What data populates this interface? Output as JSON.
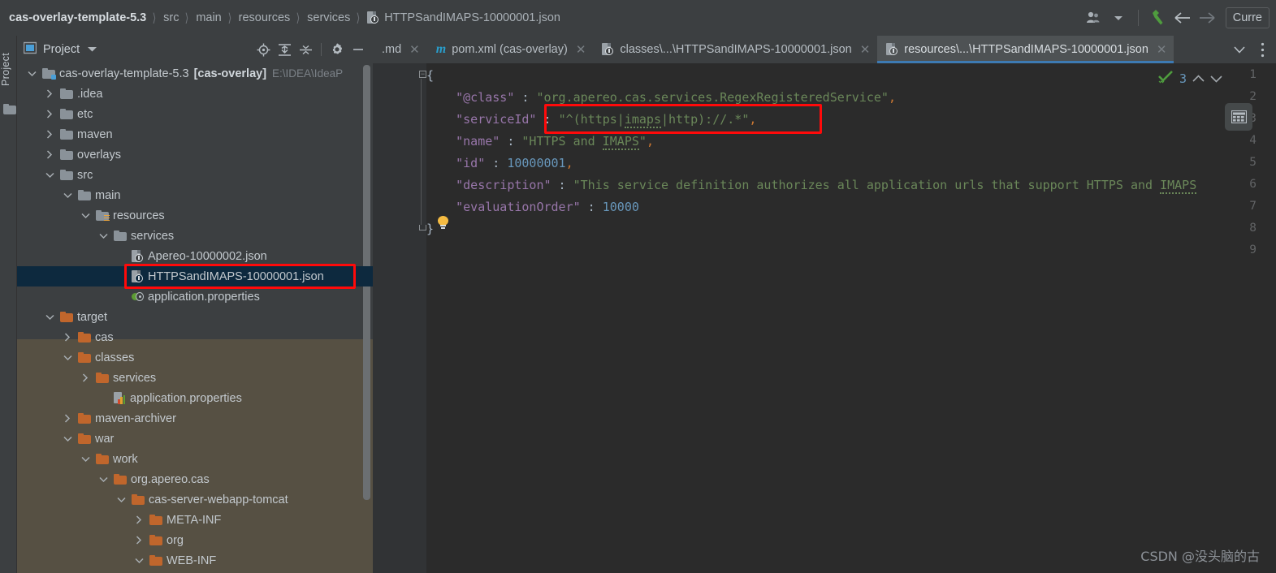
{
  "topbar": {
    "breadcrumbs": [
      {
        "label": "cas-overlay-template-5.3",
        "type": "root"
      },
      {
        "label": "src",
        "type": "dir"
      },
      {
        "label": "main",
        "type": "dir"
      },
      {
        "label": "resources",
        "type": "dir"
      },
      {
        "label": "services",
        "type": "dir"
      },
      {
        "label": "HTTPSandIMAPS-10000001.json",
        "type": "file"
      }
    ],
    "separator": "〉",
    "user_icon": "user-avatar-icon",
    "dropdown_icon": "chevron-down-icon",
    "build_icon": "hammer-icon",
    "back_icon": "arrow-left-icon",
    "forward_icon": "arrow-right-icon",
    "run_config_label": "Curre"
  },
  "toolwindow_strip": {
    "label": "Project",
    "icon": "project-folder-icon"
  },
  "panel": {
    "title": "Project",
    "caret_icon": "chevron-down-icon",
    "tools": [
      {
        "name": "locate-icon",
        "title": "Select Opened File"
      },
      {
        "name": "expand-all-icon",
        "title": "Expand All"
      },
      {
        "name": "collapse-all-icon",
        "title": "Collapse All"
      },
      {
        "name": "settings-gear-icon",
        "title": "Settings"
      },
      {
        "name": "minimize-icon",
        "title": "Hide"
      }
    ]
  },
  "tree": [
    {
      "label": "cas-overlay-template-5.3",
      "bold": "[cas-overlay]",
      "sub": "E:\\IDEA\\IdeaP",
      "indent": 0,
      "arrow": "down",
      "icon": "module-folder-icon",
      "color": "blue",
      "selected": false
    },
    {
      "label": ".idea",
      "indent": 1,
      "arrow": "right",
      "icon": "folder-icon",
      "color": "blue",
      "selected": false
    },
    {
      "label": "etc",
      "indent": 1,
      "arrow": "right",
      "icon": "folder-icon",
      "color": "blue",
      "selected": false
    },
    {
      "label": "maven",
      "indent": 1,
      "arrow": "right",
      "icon": "folder-icon",
      "color": "blue",
      "selected": false
    },
    {
      "label": "overlays",
      "indent": 1,
      "arrow": "right",
      "icon": "folder-icon",
      "color": "blue",
      "selected": false
    },
    {
      "label": "src",
      "indent": 1,
      "arrow": "down",
      "icon": "folder-icon",
      "color": "blue",
      "selected": false
    },
    {
      "label": "main",
      "indent": 2,
      "arrow": "down",
      "icon": "folder-icon",
      "color": "blue",
      "selected": false
    },
    {
      "label": "resources",
      "indent": 3,
      "arrow": "down",
      "icon": "resources-folder-icon",
      "color": "blue",
      "selected": false
    },
    {
      "label": "services",
      "indent": 4,
      "arrow": "down",
      "icon": "folder-icon",
      "color": "blue",
      "selected": false
    },
    {
      "label": "Apereo-10000002.json",
      "indent": 5,
      "arrow": "none",
      "icon": "json-file-icon",
      "selected": false
    },
    {
      "label": "HTTPSandIMAPS-10000001.json",
      "indent": 5,
      "arrow": "none",
      "icon": "json-file-icon",
      "selected": true
    },
    {
      "label": "application.properties",
      "indent": 5,
      "arrow": "none",
      "icon": "properties-file-icon",
      "selected": false
    },
    {
      "label": "target",
      "indent": 1,
      "arrow": "down",
      "icon": "folder-icon",
      "color": "orange",
      "selected": false
    },
    {
      "label": "cas",
      "indent": 2,
      "arrow": "right",
      "icon": "folder-icon",
      "color": "orange",
      "selected": false
    },
    {
      "label": "classes",
      "indent": 2,
      "arrow": "down",
      "icon": "folder-icon",
      "color": "orange",
      "selected": false
    },
    {
      "label": "services",
      "indent": 3,
      "arrow": "right",
      "icon": "folder-icon",
      "color": "orange",
      "selected": false
    },
    {
      "label": "application.properties",
      "indent": 4,
      "arrow": "none",
      "icon": "properties-chart-icon",
      "selected": false
    },
    {
      "label": "maven-archiver",
      "indent": 2,
      "arrow": "right",
      "icon": "folder-icon",
      "color": "orange",
      "selected": false
    },
    {
      "label": "war",
      "indent": 2,
      "arrow": "down",
      "icon": "folder-icon",
      "color": "orange",
      "selected": false
    },
    {
      "label": "work",
      "indent": 3,
      "arrow": "down",
      "icon": "folder-icon",
      "color": "orange",
      "selected": false
    },
    {
      "label": "org.apereo.cas",
      "indent": 4,
      "arrow": "down",
      "icon": "folder-icon",
      "color": "orange",
      "selected": false
    },
    {
      "label": "cas-server-webapp-tomcat",
      "indent": 5,
      "arrow": "down",
      "icon": "folder-icon",
      "color": "orange",
      "selected": false
    },
    {
      "label": "META-INF",
      "indent": 6,
      "arrow": "right",
      "icon": "folder-icon",
      "color": "orange",
      "selected": false
    },
    {
      "label": "org",
      "indent": 6,
      "arrow": "right",
      "icon": "folder-icon",
      "color": "orange",
      "selected": false
    },
    {
      "label": "WEB-INF",
      "indent": 6,
      "arrow": "down",
      "icon": "folder-icon",
      "color": "orange",
      "selected": false
    }
  ],
  "tabs": [
    {
      "label": ".md",
      "icon": "none",
      "active": false,
      "closable": true
    },
    {
      "label": "pom.xml (cas-overlay)",
      "icon": "maven-m-icon",
      "active": false,
      "closable": true
    },
    {
      "label": "classes\\...\\HTTPSandIMAPS-10000001.json",
      "icon": "json-file-icon",
      "active": false,
      "closable": true
    },
    {
      "label": "resources\\...\\HTTPSandIMAPS-10000001.json",
      "icon": "json-file-icon",
      "active": true,
      "closable": true
    }
  ],
  "tabbar_right": {
    "chevron_icon": "chevron-down-icon",
    "more_icon": "more-vertical-icon"
  },
  "editor": {
    "line_numbers": [
      "1",
      "2",
      "3",
      "4",
      "5",
      "6",
      "7",
      "8",
      "9"
    ],
    "lines": [
      {
        "n": 1,
        "segments": [
          {
            "t": "{",
            "c": "b"
          }
        ]
      },
      {
        "n": 2,
        "segments": [
          {
            "t": "    ",
            "c": "b"
          },
          {
            "t": "\"@class\"",
            "c": "k"
          },
          {
            "t": " : ",
            "c": "b"
          },
          {
            "t": "\"org.apereo.cas.services.RegexRegisteredService\"",
            "c": "s"
          },
          {
            "t": ",",
            "c": "p"
          }
        ]
      },
      {
        "n": 3,
        "segments": [
          {
            "t": "    ",
            "c": "b"
          },
          {
            "t": "\"serviceId\"",
            "c": "k"
          },
          {
            "t": " : ",
            "c": "b"
          },
          {
            "t": "\"^(https|imaps|http)://.*\"",
            "c": "s"
          },
          {
            "t": ",",
            "c": "p"
          }
        ]
      },
      {
        "n": 4,
        "segments": [
          {
            "t": "    ",
            "c": "b"
          },
          {
            "t": "\"name\"",
            "c": "k"
          },
          {
            "t": " : ",
            "c": "b"
          },
          {
            "t": "\"HTTPS and IMAPS\"",
            "c": "s"
          },
          {
            "t": ",",
            "c": "p"
          }
        ]
      },
      {
        "n": 5,
        "segments": [
          {
            "t": "    ",
            "c": "b"
          },
          {
            "t": "\"id\"",
            "c": "k"
          },
          {
            "t": " : ",
            "c": "b"
          },
          {
            "t": "10000001",
            "c": "n"
          },
          {
            "t": ",",
            "c": "p"
          }
        ]
      },
      {
        "n": 6,
        "segments": [
          {
            "t": "    ",
            "c": "b"
          },
          {
            "t": "\"description\"",
            "c": "k"
          },
          {
            "t": " : ",
            "c": "b"
          },
          {
            "t": "\"This service definition authorizes all application urls that support HTTPS and IMAPS",
            "c": "s"
          }
        ]
      },
      {
        "n": 7,
        "segments": [
          {
            "t": "    ",
            "c": "b"
          },
          {
            "t": "\"evaluationOrder\"",
            "c": "k"
          },
          {
            "t": " : ",
            "c": "b"
          },
          {
            "t": "10000",
            "c": "n"
          }
        ]
      },
      {
        "n": 8,
        "segments": [
          {
            "t": "}",
            "c": "b"
          }
        ]
      },
      {
        "n": 9,
        "segments": []
      }
    ],
    "intention_bulb": "lightbulb-icon",
    "inspection": {
      "status_icon": "green-check-icon",
      "count": "3",
      "up_icon": "chevron-up-icon",
      "down_icon": "chevron-down-icon"
    },
    "grid_button_icon": "table-grid-icon"
  },
  "annotations": {
    "redbox_code": {
      "label": "red-highlight-serviceid"
    },
    "redbox_tree": {
      "label": "red-highlight-selected-file"
    }
  },
  "watermark": "CSDN @没头脑的古",
  "colors": {
    "accent_blue": "#3d7ab3",
    "selection_bg": "#0d293e",
    "annotation_red": "#ff0a0a",
    "editor_bg": "#2b2b2b",
    "panel_bg": "#3c3f41",
    "string_green": "#6a8759",
    "key_purple": "#9876aa",
    "number_blue": "#6897bb",
    "folder_orange": "#c0662c"
  }
}
